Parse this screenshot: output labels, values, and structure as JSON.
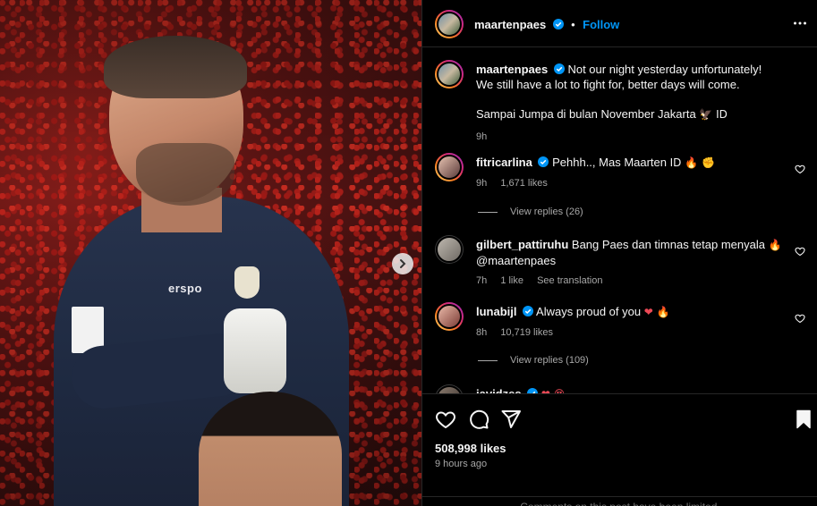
{
  "media": {
    "jersey_brand": "erspo"
  },
  "header": {
    "username": "maartenpaes",
    "separator": "•",
    "follow_label": "Follow"
  },
  "caption": {
    "username": "maartenpaes",
    "line1": "Not our night yesterday unfortunately!",
    "line2": "We still have a lot to fight for, better days will come.",
    "line3": "Sampai Jumpa di bulan November Jakarta",
    "line3_emoji": "🦅 ID",
    "time": "9h"
  },
  "comments": [
    {
      "username": "fitricarlina",
      "verified": true,
      "text": "Pehhh.., Mas Maarten",
      "emoji": "ID 🔥 ✊",
      "time": "9h",
      "likes": "1,671 likes",
      "view_replies": "View replies (26)"
    },
    {
      "username": "gilbert_pattiruhu",
      "verified": false,
      "text": "Bang Paes dan timnas tetap menyala",
      "emoji": "🔥",
      "text2": "@maartenpaes",
      "time": "7h",
      "likes": "1 like",
      "translation": "See translation"
    },
    {
      "username": "lunabijl",
      "verified": true,
      "text": "Always proud of you",
      "emoji": "❤ 🔥",
      "time": "8h",
      "likes": "10,719 likes",
      "view_replies": "View replies (109)"
    },
    {
      "username": "javidzes",
      "verified": true,
      "emoji": "❤ 😍"
    }
  ],
  "footer": {
    "likes": "508,998 likes",
    "time_ago": "9 hours ago",
    "limited_notice": "Comments on this post have been limited."
  },
  "colors": {
    "accent": "#0095f6",
    "verified": "#0095f6",
    "muted": "#a8a8a8",
    "background": "#000000"
  },
  "icons": [
    "more-horizontal-icon",
    "next-arrow-icon",
    "heart-icon",
    "comment-icon",
    "share-icon",
    "bookmark-icon",
    "verified-badge-icon"
  ]
}
